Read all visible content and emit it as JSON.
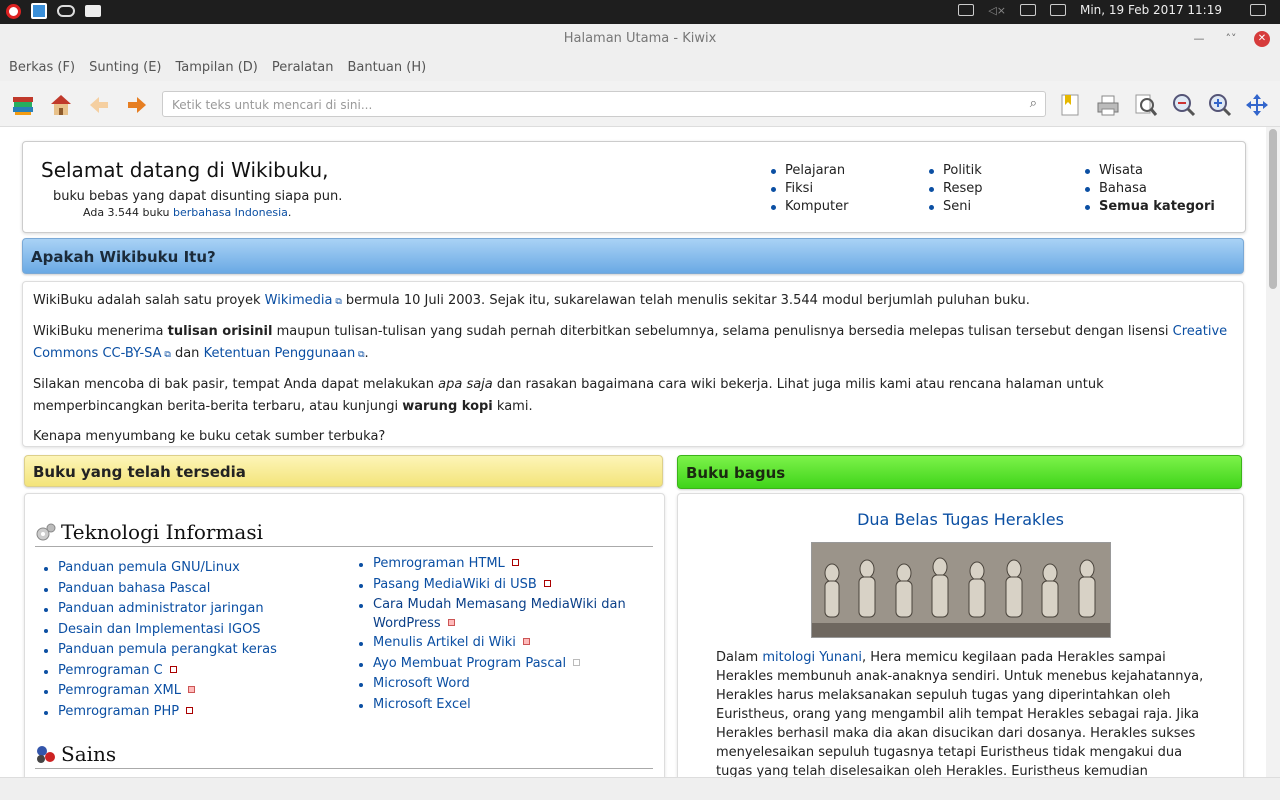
{
  "system": {
    "clock": "Min, 19 Feb 2017 11:19"
  },
  "window": {
    "title": "Halaman Utama - Kiwix"
  },
  "menu": [
    "Berkas (F)",
    "Sunting (E)",
    "Tampilan (D)",
    "Peralatan",
    "Bantuan (H)"
  ],
  "search": {
    "placeholder": "Ketik teks untuk mencari di sini..."
  },
  "welcome": {
    "title": "Selamat datang di Wikibuku,",
    "subtitle": "buku bebas yang dapat disunting siapa pun.",
    "count_prefix": "Ada 3.544 buku",
    "count_link": "berbahasa Indonesia",
    "count_suffix": ".",
    "categories_col1": [
      "Pelajaran",
      "Fiksi",
      "Komputer"
    ],
    "categories_col2": [
      "Politik",
      "Resep",
      "Seni"
    ],
    "categories_col3": [
      "Wisata",
      "Bahasa",
      "Semua kategori"
    ]
  },
  "about": {
    "header": "Apakah Wikibuku Itu?",
    "p1_a": "WikiBuku adalah salah satu proyek ",
    "p1_link": "Wikimedia",
    "p1_b": " bermula 10 Juli 2003. Sejak itu, sukarelawan telah menulis sekitar 3.544 modul berjumlah puluhan buku.",
    "p2_a": "WikiBuku menerima ",
    "p2_bold": "tulisan orisinil",
    "p2_b": " maupun tulisan-tulisan yang sudah pernah diterbitkan sebelumnya, selama penulisnya bersedia melepas tulisan tersebut dengan lisensi ",
    "p2_link1": "Creative Commons CC-BY-SA",
    "p2_c": " dan ",
    "p2_link2": "Ketentuan Penggunaan",
    "p2_d": ".",
    "p3_a": "Silakan mencoba di bak pasir, tempat Anda dapat melakukan ",
    "p3_italic": "apa saja",
    "p3_b": " dan rasakan bagaimana cara wiki bekerja. Lihat juga milis kami atau rencana halaman untuk memperbincangkan berita-berita terbaru, atau kunjungi ",
    "p3_bold": "warung kopi",
    "p3_c": " kami.",
    "p4": "Kenapa menyumbang ke buku cetak sumber terbuka?"
  },
  "available": {
    "header": "Buku yang telah tersedia",
    "section1": "Teknologi Informasi",
    "list_left": [
      "Panduan pemula GNU/Linux",
      "Panduan bahasa Pascal",
      "Panduan administrator jaringan",
      "Desain dan Implementasi IGOS",
      "Panduan pemula perangkat keras",
      "Pemrograman C",
      "Pemrograman XML",
      "Pemrograman PHP"
    ],
    "list_right": [
      "Pemrograman HTML",
      "Pasang MediaWiki di USB",
      "Cara Mudah Memasang MediaWiki dan WordPress",
      "Menulis Artikel di Wiki",
      "Ayo Membuat Program Pascal",
      "Microsoft Word",
      "Microsoft Excel"
    ],
    "section2": "Sains"
  },
  "featured": {
    "header": "Buku bagus",
    "title": "Dua Belas Tugas Herakles",
    "text_a": "Dalam ",
    "text_link": "mitologi Yunani",
    "text_b": ", Hera memicu kegilaan pada Herakles sampai Herakles membunuh anak-anaknya sendiri. Untuk menebus kejahatannya, Herakles harus melaksanakan sepuluh tugas yang diperintahkan oleh Euristheus, orang yang mengambil alih tempat Herakles sebagai raja. Jika Herakles berhasil maka dia akan disucikan dari dosanya. Herakles sukses menyelesaikan sepuluh tugasnya tetapi Euristheus tidak mengakui dua tugas yang telah diselesaikan oleh Herakles. Euristheus kemudian memberinya dua tugas"
  }
}
